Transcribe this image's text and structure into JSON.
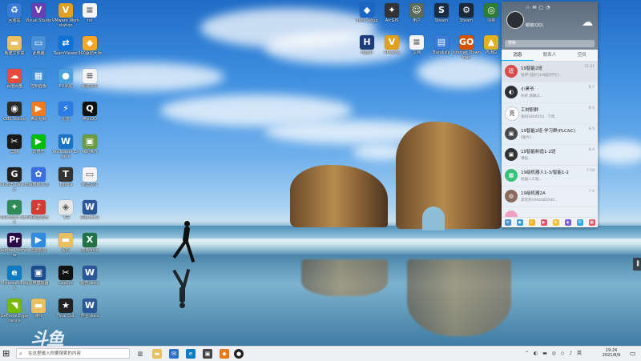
{
  "desktop": {
    "icons": [
      {
        "label": "回收站",
        "icon": "recycle-bin-icon",
        "color": "#3a7bd5",
        "glyph": "♻"
      },
      {
        "label": "Visual Studio",
        "icon": "visual-studio-icon",
        "color": "#6a3fb2",
        "glyph": "V"
      },
      {
        "label": "VMware Workstation",
        "icon": "vmware-icon",
        "color": "#e0a020",
        "glyph": "V"
      },
      {
        "label": "txt",
        "icon": "text-file-icon",
        "color": "#f4f4f4",
        "glyph": "≡"
      },
      {
        "label": "新建文件夹",
        "icon": "folder-icon",
        "color": "#e8c060",
        "glyph": "▬"
      },
      {
        "label": "此电脑",
        "icon": "this-pc-icon",
        "color": "#4a90d9",
        "glyph": "▭"
      },
      {
        "label": "TeamViewer",
        "icon": "teamviewer-icon",
        "color": "#0e72d6",
        "glyph": "⇄"
      },
      {
        "label": "360驱动大师",
        "icon": "driver-master-icon",
        "color": "#f5a623",
        "glyph": "◆"
      },
      {
        "label": "百度网盘",
        "icon": "baidu-netdisk-icon",
        "color": "#e84a3c",
        "glyph": "☁"
      },
      {
        "label": "控制面板",
        "icon": "control-panel-icon",
        "color": "#3f8fd8",
        "glyph": "▦"
      },
      {
        "label": "EV录屏",
        "icon": "ev-recorder-icon",
        "color": "#4aa3df",
        "glyph": "●"
      },
      {
        "label": "新建文本",
        "icon": "text-file-icon",
        "color": "#f4f4f4",
        "glyph": "≡"
      },
      {
        "label": "OBS Studio",
        "icon": "obs-icon",
        "color": "#2b2b2b",
        "glyph": "◉"
      },
      {
        "label": "腾讯视频",
        "icon": "tencent-video-icon",
        "color": "#f07c1f",
        "glyph": "▶"
      },
      {
        "label": "迅雷",
        "icon": "thunder-icon",
        "color": "#2c7ce5",
        "glyph": "⚡"
      },
      {
        "label": "腾讯QQ",
        "icon": "qq-icon",
        "color": "#111",
        "glyph": "Q"
      },
      {
        "label": "剪映",
        "icon": "capcut-icon",
        "color": "#1a1a1a",
        "glyph": "✂"
      },
      {
        "label": "爱奇艺",
        "icon": "iqiyi-icon",
        "color": "#00be06",
        "glyph": "▶"
      },
      {
        "label": "Wallpaper Engine",
        "icon": "wallpaper-engine-icon",
        "color": "#1b73c6",
        "glyph": "W"
      },
      {
        "label": "我的世界",
        "icon": "minecraft-icon",
        "color": "#6c9c3e",
        "glyph": "▣"
      },
      {
        "label": "Github Desktop",
        "icon": "github-icon",
        "color": "#222",
        "glyph": "G"
      },
      {
        "label": "百度输入法",
        "icon": "baidu-icon",
        "color": "#3b6fe0",
        "glyph": "✿"
      },
      {
        "label": "Typora",
        "icon": "typora-icon",
        "color": "#333",
        "glyph": "T"
      },
      {
        "label": "新建文件",
        "icon": "blank-file-icon",
        "color": "#f4f4f4",
        "glyph": "▭"
      },
      {
        "label": "Microsoft Store",
        "icon": "store-icon",
        "color": "#2e8b57",
        "glyph": "✦"
      },
      {
        "label": "网易云音乐",
        "icon": "netease-music-icon",
        "color": "#d43c33",
        "glyph": "♪"
      },
      {
        "label": "飞书",
        "icon": "feishu-icon",
        "color": "#e6e6e6",
        "glyph": "◈"
      },
      {
        "label": "文档.docx",
        "icon": "word-doc-icon",
        "color": "#2b579a",
        "glyph": "W"
      },
      {
        "label": "Adobe Premiere",
        "icon": "premiere-icon",
        "color": "#2a0b45",
        "glyph": "Pr"
      },
      {
        "label": "迅雷影音",
        "icon": "thunder-player-icon",
        "color": "#2f8be0",
        "glyph": "▶"
      },
      {
        "label": "资料",
        "icon": "folder-icon",
        "color": "#e8c060",
        "glyph": "▬"
      },
      {
        "label": "表格.xlsx",
        "icon": "excel-icon",
        "color": "#217346",
        "glyph": "X"
      },
      {
        "label": "Microsoft Edge",
        "icon": "edge-icon",
        "color": "#0f7bc2",
        "glyph": "e"
      },
      {
        "label": "雷电模拟器",
        "icon": "emulator-icon",
        "color": "#1c4c8c",
        "glyph": "▣"
      },
      {
        "label": "CapCut",
        "icon": "capcut-icon",
        "color": "#111",
        "glyph": "✂"
      },
      {
        "label": "报告.docx",
        "icon": "word-doc-icon",
        "color": "#2b579a",
        "glyph": "W"
      },
      {
        "label": "GeForce Experience",
        "icon": "nvidia-icon",
        "color": "#76b900",
        "glyph": "◥"
      },
      {
        "label": "课件",
        "icon": "folder-icon",
        "color": "#e8c060",
        "glyph": "▬"
      },
      {
        "label": "Final Cut",
        "icon": "video-editor-icon",
        "color": "#222",
        "glyph": "★"
      },
      {
        "label": "作业.docx",
        "icon": "word-doc-icon",
        "color": "#2b579a",
        "glyph": "W"
      }
    ],
    "top_icons": [
      {
        "label": "Inno Setup",
        "icon": "setup-icon",
        "color": "#1c66c4",
        "glyph": "◆"
      },
      {
        "label": "ArcGIS",
        "icon": "arcgis-icon",
        "color": "#333",
        "glyph": "✦"
      },
      {
        "label": "用户",
        "icon": "user-photo-icon",
        "color": "#5a6b58",
        "glyph": "☺"
      },
      {
        "label": "Steam",
        "icon": "steam-icon",
        "color": "#1a2c44",
        "glyph": "S"
      },
      {
        "label": "Steam",
        "icon": "steam-icon",
        "color": "#1b2838",
        "glyph": "⚙"
      },
      {
        "label": "项目",
        "icon": "app-icon",
        "color": "#2e7d32",
        "glyph": "◎"
      },
      {
        "label": "Hyper",
        "icon": "hyper-icon",
        "color": "#1c3d7a",
        "glyph": "H"
      },
      {
        "label": "VMware",
        "icon": "vmware-icon",
        "color": "#e0a020",
        "glyph": "V"
      },
      {
        "label": "文档",
        "icon": "text-file-icon",
        "color": "#f4f4f4",
        "glyph": "≡"
      },
      {
        "label": "Bandizip",
        "icon": "bandizip-icon",
        "color": "#3a7bd5",
        "glyph": "▤"
      },
      {
        "label": "Internet Download",
        "icon": "idm-icon",
        "color": "#d35400",
        "glyph": "GO"
      },
      {
        "label": "PUBG",
        "icon": "pubg-icon",
        "color": "#e0b020",
        "glyph": "▲"
      }
    ]
  },
  "qq": {
    "username": "眼镜(QQ)",
    "search_placeholder": "搜索",
    "tabs": [
      "消息",
      "联系人",
      "空间"
    ],
    "conversations": [
      {
        "name": "19智能2班",
        "msg": "张伊:[图片]19班同学们...",
        "time": "15:41",
        "color": "#d94a4a",
        "glyph": "班",
        "selected": true
      },
      {
        "name": "小黑爷",
        "msg": "你好,请确认...",
        "time": "8-7",
        "color": "#2c2f33",
        "glyph": "◐",
        "selected": false
      },
      {
        "name": "工材职群",
        "msg": "张同1804010...下周...",
        "time": "8-5",
        "color": "#fff",
        "glyph": "亮",
        "selected": false
      },
      {
        "name": "19智能2班-学习群(PLC&C)",
        "msg": "[图片]...",
        "time": "8-5",
        "color": "#4a4a4a",
        "glyph": "▣",
        "selected": false
      },
      {
        "name": "19智能制造1-2班",
        "msg": "课程...",
        "time": "8-4",
        "color": "#333",
        "glyph": "▣",
        "selected": false
      },
      {
        "name": "19级机器人1-3/智能1-2",
        "msg": "机器人工程...",
        "time": "7-18",
        "color": "#39c07a",
        "glyph": "▦",
        "selected": false
      },
      {
        "name": "19级机器2A",
        "msg": "李老师1942083040...",
        "time": "7-4",
        "color": "#8a6a5a",
        "glyph": "◍",
        "selected": false
      },
      {
        "name": "",
        "msg": "",
        "time": "",
        "color": "#f0a0c0",
        "glyph": "",
        "selected": false
      }
    ]
  },
  "taskbar": {
    "search_placeholder": "在这里输入你要搜索的内容",
    "time": "19:24",
    "date": "2021/8/9"
  },
  "watermark": "斗鱼"
}
